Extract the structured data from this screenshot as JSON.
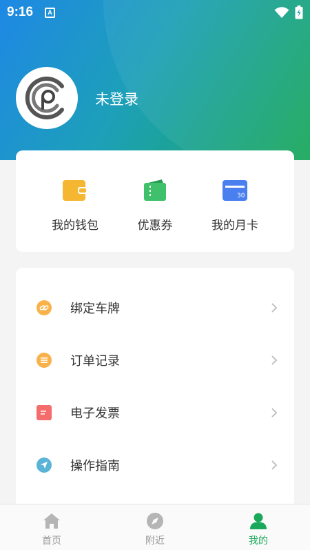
{
  "status_bar": {
    "time": "9:16",
    "notification_letter": "A"
  },
  "profile": {
    "login_status": "未登录"
  },
  "wallet": {
    "items": [
      {
        "label": "我的钱包",
        "icon": "wallet-icon",
        "color": "#f5b731"
      },
      {
        "label": "优惠券",
        "icon": "coupon-icon",
        "color": "#3fc06a"
      },
      {
        "label": "我的月卡",
        "icon": "monthly-card-icon",
        "color": "#4a7ff0",
        "badge": "30"
      }
    ]
  },
  "menu": {
    "items": [
      {
        "label": "绑定车牌",
        "icon": "link-icon",
        "color": "#f9b24a"
      },
      {
        "label": "订单记录",
        "icon": "list-icon",
        "color": "#f9b24a"
      },
      {
        "label": "电子发票",
        "icon": "invoice-icon",
        "color": "#f56c6c"
      },
      {
        "label": "操作指南",
        "icon": "navigation-icon",
        "color": "#5ab4d8"
      }
    ]
  },
  "tabbar": {
    "tabs": [
      {
        "label": "首页",
        "icon": "home-icon",
        "active": false
      },
      {
        "label": "附近",
        "icon": "compass-icon",
        "active": false
      },
      {
        "label": "我的",
        "icon": "person-icon",
        "active": true
      }
    ],
    "active_color": "#1aa85a",
    "inactive_color": "#999999"
  }
}
